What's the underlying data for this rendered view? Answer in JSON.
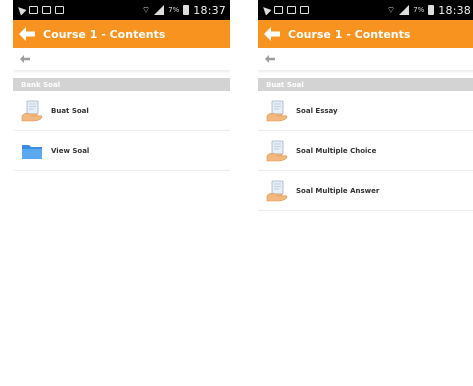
{
  "statusbar": {
    "left": {
      "time": "18:37",
      "battery": "7%"
    },
    "right": {
      "time": "18:38",
      "battery": "7%"
    }
  },
  "appbar": {
    "title_left": "Course 1 - Contents",
    "title_right": "Course 1 - Contents"
  },
  "left_screen": {
    "section_title": "Bank Soal",
    "items": [
      {
        "label": "Buat Soal",
        "icon": "hand-document-icon"
      },
      {
        "label": "View Soal",
        "icon": "folder-icon"
      }
    ]
  },
  "right_screen": {
    "section_title": "Buat Soal",
    "items": [
      {
        "label": "Soal Essay",
        "icon": "hand-document-icon"
      },
      {
        "label": "Soal Multiple Choice",
        "icon": "hand-document-icon"
      },
      {
        "label": "Soal Multiple Answer",
        "icon": "hand-document-icon"
      }
    ]
  },
  "colors": {
    "appbar": "#f7931e",
    "section_header": "#d3d3d3",
    "statusbar": "#000000"
  }
}
